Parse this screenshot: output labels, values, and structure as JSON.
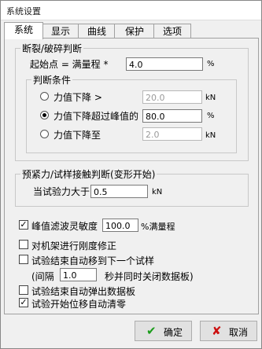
{
  "window": {
    "title": "系统设置"
  },
  "tabs": [
    "系统",
    "显示",
    "曲线",
    "保护",
    "选项"
  ],
  "break_group": {
    "legend": "断裂/破碎判断",
    "start_label": "起始点 = 满量程 *",
    "start_value": "4.0",
    "start_unit": "%",
    "condition_legend": "判断条件",
    "options": [
      {
        "label": "力值下降 >",
        "value": "20.0",
        "unit": "kN",
        "selected": false
      },
      {
        "label": "力值下降超过峰值的",
        "value": "80.0",
        "unit": "%",
        "selected": true
      },
      {
        "label": "力值下降至",
        "value": "2.0",
        "unit": "kN",
        "selected": false
      }
    ]
  },
  "preload_group": {
    "legend": "预紧力/试样接触判断(变形开始)",
    "label": "当试验力大于",
    "value": "0.5",
    "unit": "kN"
  },
  "filter": {
    "label": "峰值滤波灵敏度",
    "value": "100.0",
    "unit": "%满量程",
    "checked": true
  },
  "stiffness": {
    "label": "对机架进行刚度修正",
    "checked": false
  },
  "auto_next": {
    "label": "试验结束自动移到下一个试样",
    "interval_prefix": "(间隔",
    "interval_value": "1.0",
    "interval_suffix": "秒并同时关闭数据板)",
    "checked": false
  },
  "auto_popup": {
    "label": "试验结束自动弹出数据板",
    "checked": false
  },
  "auto_zero": {
    "label": "试验开始位移自动清零",
    "checked": true
  },
  "buttons": {
    "ok": "确定",
    "cancel": "取消"
  },
  "icons": {
    "ok": "green-checkmark-icon",
    "cancel": "red-x-icon"
  },
  "colors": {
    "ok_icon": "#1a9c1a",
    "cancel_icon": "#cc1010"
  }
}
